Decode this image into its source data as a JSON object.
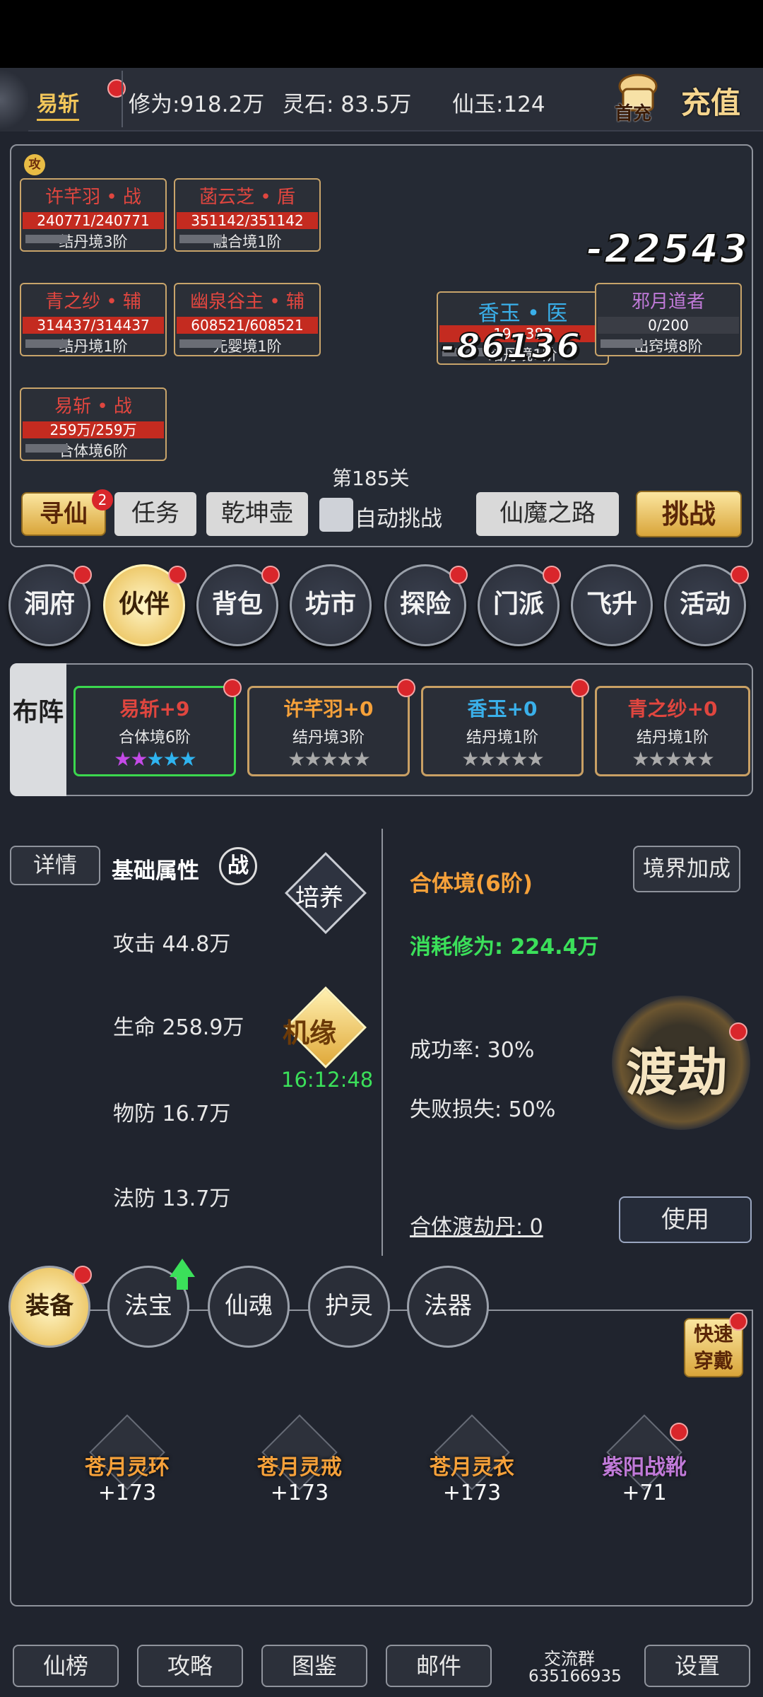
{
  "topbar": {
    "player_name": "易斩",
    "cultivation": "修为:918.2万",
    "spirit_stone": "灵石: 83.5万",
    "jade": "仙玉:124",
    "charge_icon_label": "首充",
    "charge_label": "充值"
  },
  "battle": {
    "attack_badge": "攻",
    "allies": [
      {
        "name": "许芊羽 • 战",
        "hp": "240771/240771",
        "rank": "结丹境3阶"
      },
      {
        "name": "菡云芝 • 盾",
        "hp": "351142/351142",
        "rank": "融合境1阶"
      },
      {
        "name": "青之纱 • 辅",
        "hp": "314437/314437",
        "rank": "结丹境1阶"
      },
      {
        "name": "幽泉谷主 • 辅",
        "hp": "608521/608521",
        "rank": "元婴境1阶"
      },
      {
        "name": "易斩 • 战",
        "hp": "259万/259万",
        "rank": "合体境6阶"
      }
    ],
    "target_healer": {
      "name": "香玉 • 医",
      "hp": "19…383",
      "rank": "结丹境1阶"
    },
    "enemy": {
      "name": "邪月道者",
      "hp": "0/200",
      "rank": "出窍境8阶"
    },
    "damage_1": "-22543",
    "damage_2": "-86136",
    "stage": "第185关"
  },
  "actions": {
    "seek": "寻仙",
    "seek_badge": "2",
    "task": "任务",
    "pot": "乾坤壶",
    "auto": "自动挑战",
    "road": "仙魔之路",
    "challenge": "挑战"
  },
  "nav": [
    "洞府",
    "伙伴",
    "背包",
    "坊市",
    "探险",
    "门派",
    "飞升",
    "活动"
  ],
  "formation": {
    "label": "布阵",
    "cards": [
      {
        "name": "易斩+9",
        "rank": "合体境6阶",
        "stars": "★★★★★"
      },
      {
        "name": "许芊羽+0",
        "rank": "结丹境3阶",
        "stars": "★★★★★"
      },
      {
        "name": "香玉+0",
        "rank": "结丹境1阶",
        "stars": "★★★★★"
      },
      {
        "name": "青之纱+0",
        "rank": "结丹境1阶",
        "stars": "★★★★★"
      }
    ]
  },
  "detail": {
    "details_btn": "详情",
    "base_attr": "基础属性",
    "class_badge": "战",
    "train": "培养",
    "attack": "攻击 44.8万",
    "life": "生命 258.9万",
    "phys_def": "物防 16.7万",
    "mag_def": "法防 13.7万",
    "chance": "机缘",
    "timer": "16:12:48",
    "realm": "合体境(6阶)",
    "realm_bonus": "境界加成",
    "cost": "消耗修为: 224.4万",
    "success": "成功率: 30%",
    "fail": "失败损失: 50%",
    "tribulation": "渡劫",
    "pill": "合体渡劫丹: 0",
    "use": "使用"
  },
  "equip": {
    "tabs": [
      "装备",
      "法宝",
      "仙魂",
      "护灵",
      "法器"
    ],
    "quick": "快速穿戴",
    "items": [
      {
        "name": "苍月灵环",
        "level": "+173"
      },
      {
        "name": "苍月灵戒",
        "level": "+173"
      },
      {
        "name": "苍月灵衣",
        "level": "+173"
      },
      {
        "name": "紫阳战靴",
        "level": "+71"
      }
    ]
  },
  "bottom": {
    "ranking": "仙榜",
    "guide": "攻略",
    "codex": "图鉴",
    "mail": "邮件",
    "group_label": "交流群",
    "group_id": "635166935",
    "settings": "设置"
  },
  "colors": {
    "gold": "#f2c65a",
    "hp_red": "#c42b20",
    "ally_name": "#e0463f",
    "healer_name": "#3ab0ea",
    "enemy_name": "#c07ad8",
    "realm_orange": "#f6a13a",
    "green": "#3be05a"
  }
}
